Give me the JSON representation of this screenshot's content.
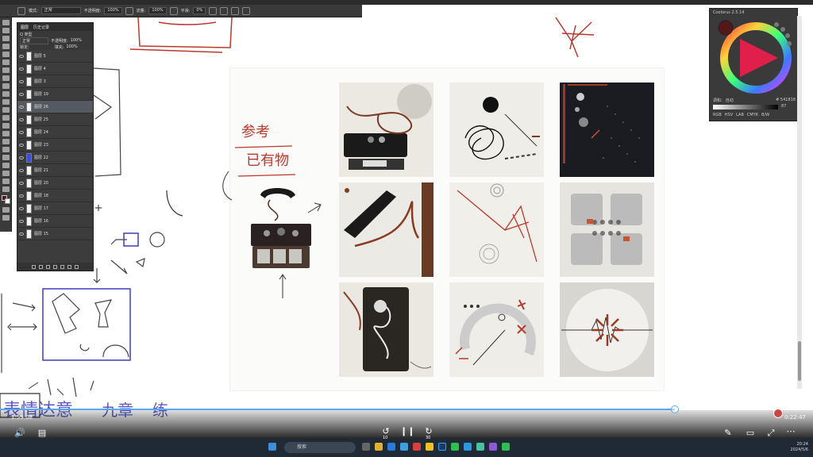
{
  "options_bar": {
    "mode_label": "模式:",
    "mode_value": "正常",
    "opacity_label": "不透明度:",
    "opacity_value": "100%",
    "flow_label": "流量:",
    "flow_value": "100%",
    "smooth_label": "平滑:",
    "smooth_value": "0%"
  },
  "layers_panel": {
    "tabs": [
      "图层",
      "历史记录"
    ],
    "kind_label": "Q 类型",
    "blend_mode": "正常",
    "opacity_label": "不透明度:",
    "opacity_value": "100%",
    "lock_label": "锁定:",
    "fill_label": "填充:",
    "fill_value": "100%",
    "layers": [
      {
        "name": "图层 5",
        "selected": false,
        "thumb": "white"
      },
      {
        "name": "图层 4",
        "selected": false,
        "thumb": "white"
      },
      {
        "name": "图层 3",
        "selected": false,
        "thumb": "white"
      },
      {
        "name": "图层 19",
        "selected": false,
        "thumb": "white"
      },
      {
        "name": "图层 26",
        "selected": true,
        "thumb": "white"
      },
      {
        "name": "图层 25",
        "selected": false,
        "thumb": "white"
      },
      {
        "name": "图层 24",
        "selected": false,
        "thumb": "white"
      },
      {
        "name": "图层 23",
        "selected": false,
        "thumb": "white"
      },
      {
        "name": "图层 22",
        "selected": false,
        "thumb": "blue"
      },
      {
        "name": "图层 21",
        "selected": false,
        "thumb": "white"
      },
      {
        "name": "图层 20",
        "selected": false,
        "thumb": "white"
      },
      {
        "name": "图层 18",
        "selected": false,
        "thumb": "white"
      },
      {
        "name": "图层 17",
        "selected": false,
        "thumb": "white"
      },
      {
        "name": "图层 16",
        "selected": false,
        "thumb": "white"
      },
      {
        "name": "图层 15",
        "selected": false,
        "thumb": "white"
      }
    ]
  },
  "color_panel": {
    "title": "Coolorus 2.5.14",
    "hex_value": "# 541818",
    "mixer_label": "调和:",
    "mixer_mode": "自动",
    "value_readout": "87",
    "tabs": [
      "RGB",
      "HSV",
      "LAB",
      "CMYK",
      "B/W"
    ],
    "current_color": "#541818"
  },
  "handwriting": {
    "ref_label_1": "参考",
    "ref_label_2": "已有物",
    "bottom_word_1": "表情达意",
    "bottom_word_2": "九章",
    "bottom_word_3": "练"
  },
  "video": {
    "elapsed": "1:59:08",
    "remaining": "0:22:47",
    "progress_percent": 83,
    "rewind_label": "10",
    "forward_label": "30"
  },
  "taskbar": {
    "search_placeholder": "搜索",
    "time": "20:24",
    "date": "2024/5/6"
  },
  "colors": {
    "accent_blue": "#5aa6ff",
    "sketch_red": "#b83a2c",
    "sketch_blue": "#3d3fb8",
    "ps_panel": "#3c3c3c"
  }
}
